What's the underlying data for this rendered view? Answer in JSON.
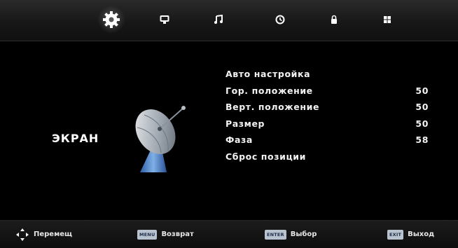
{
  "tabs": [
    {
      "icon": "gear-icon",
      "active": true
    },
    {
      "icon": "monitor-icon",
      "active": false
    },
    {
      "icon": "music-note-icon",
      "active": false
    },
    {
      "icon": "clock-icon",
      "active": false
    },
    {
      "icon": "lock-icon",
      "active": false
    },
    {
      "icon": "grid-icon",
      "active": false
    }
  ],
  "section_title": "ЭКРАН",
  "menu": {
    "items": [
      {
        "label": "Авто настройка",
        "value": ""
      },
      {
        "label": "Гор. положение",
        "value": "50"
      },
      {
        "label": "Верт. положение",
        "value": "50"
      },
      {
        "label": "Размер",
        "value": "50"
      },
      {
        "label": "Фаза",
        "value": "58"
      },
      {
        "label": "Сброс позиции",
        "value": ""
      }
    ]
  },
  "footer": {
    "move": {
      "icon": "dpad-icon",
      "label": "Перемещ"
    },
    "back": {
      "key": "MENU",
      "label": "Возврат"
    },
    "select": {
      "key": "ENTER",
      "label": "Выбор"
    },
    "exit": {
      "key": "EXIT",
      "label": "Выход"
    }
  },
  "colors": {
    "background": "#000000",
    "accent": "#ffffff",
    "key_badge": "#b9c3d0"
  }
}
